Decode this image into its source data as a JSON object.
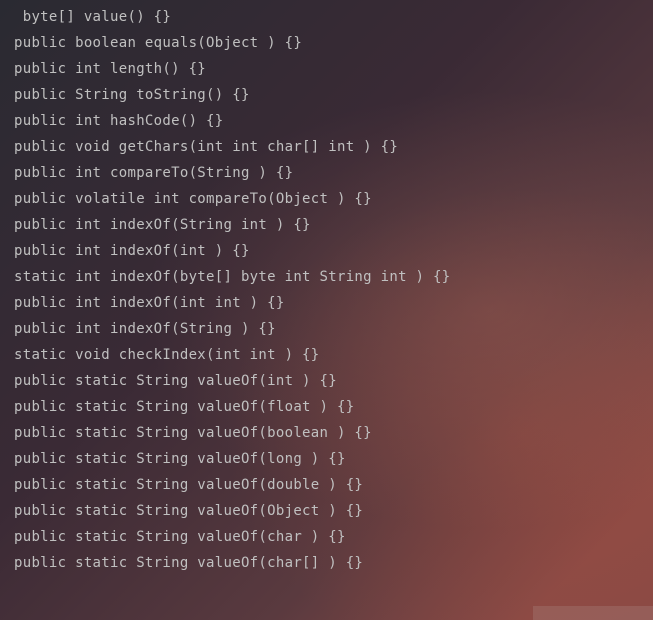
{
  "code_lines": [
    " byte[] value() {}",
    "public boolean equals(Object ) {}",
    "public int length() {}",
    "public String toString() {}",
    "public int hashCode() {}",
    "public void getChars(int int char[] int ) {}",
    "public int compareTo(String ) {}",
    "public volatile int compareTo(Object ) {}",
    "public int indexOf(String int ) {}",
    "public int indexOf(int ) {}",
    "static int indexOf(byte[] byte int String int ) {}",
    "public int indexOf(int int ) {}",
    "public int indexOf(String ) {}",
    "static void checkIndex(int int ) {}",
    "public static String valueOf(int ) {}",
    "public static String valueOf(float ) {}",
    "public static String valueOf(boolean ) {}",
    "public static String valueOf(long ) {}",
    "public static String valueOf(double ) {}",
    "public static String valueOf(Object ) {}",
    "public static String valueOf(char ) {}",
    "public static String valueOf(char[] ) {}"
  ]
}
